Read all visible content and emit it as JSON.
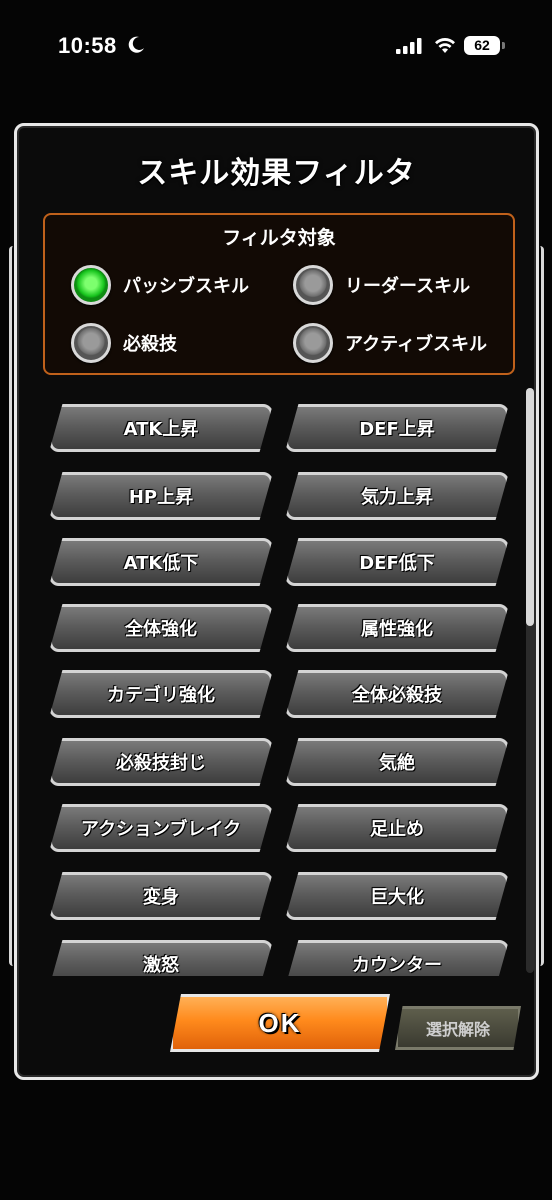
{
  "status_bar": {
    "time": "10:58",
    "battery": "62"
  },
  "dialog": {
    "title": "スキル効果フィルタ",
    "target": {
      "label": "フィルタ対象",
      "options": [
        {
          "label": "パッシブスキル",
          "selected": true
        },
        {
          "label": "リーダースキル",
          "selected": false
        },
        {
          "label": "必殺技",
          "selected": false
        },
        {
          "label": "アクティブスキル",
          "selected": false
        }
      ]
    },
    "filters": [
      "ATK上昇",
      "DEF上昇",
      "HP上昇",
      "気力上昇",
      "ATK低下",
      "DEF低下",
      "全体強化",
      "属性強化",
      "カテゴリ強化",
      "全体必殺技",
      "必殺技封じ",
      "気絶",
      "アクションブレイク",
      "足止め",
      "変身",
      "巨大化",
      "激怒",
      "カウンター"
    ],
    "ok_label": "OK",
    "clear_label": "選択解除"
  },
  "colors": {
    "accent_orange": "#ff8a1c",
    "selected_green": "#17c41d",
    "target_border": "#c0611b"
  }
}
